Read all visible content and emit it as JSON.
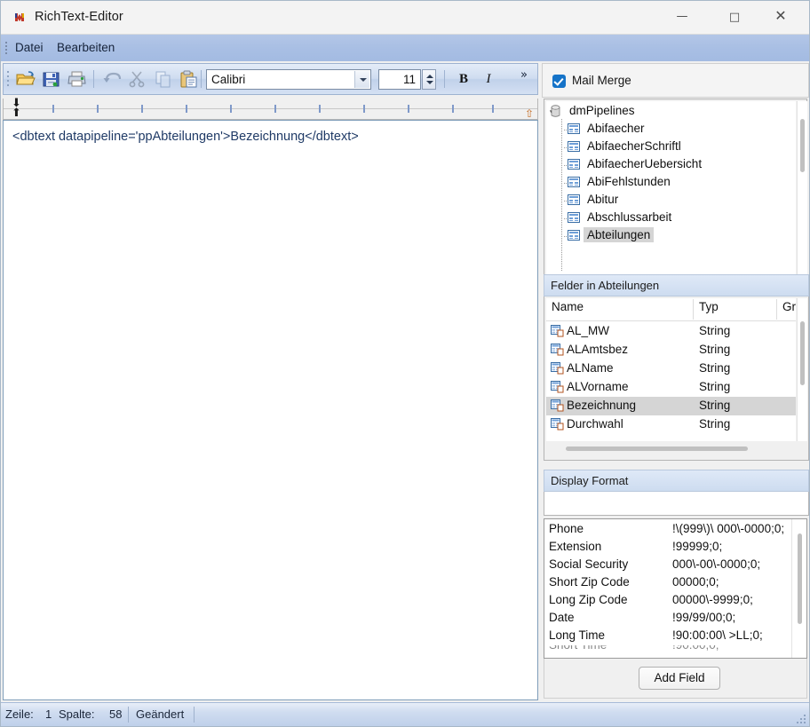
{
  "window": {
    "title": "RichText-Editor",
    "icon": "app-icon",
    "minimize_label": "—",
    "maximize_label": "□",
    "close_label": "✕"
  },
  "menu": {
    "items": [
      {
        "label": "Datei"
      },
      {
        "label": "Bearbeiten"
      }
    ]
  },
  "toolbar": {
    "buttons": [
      {
        "name": "open-button",
        "icon": "open-folder-icon",
        "enabled": true
      },
      {
        "name": "save-button",
        "icon": "floppy-disk-icon",
        "enabled": true
      },
      {
        "name": "print-button",
        "icon": "printer-icon",
        "enabled": true
      },
      {
        "name": "undo-button",
        "icon": "undo-arrow-icon",
        "enabled": false
      },
      {
        "name": "cut-button",
        "icon": "scissors-icon",
        "enabled": false
      },
      {
        "name": "copy-button",
        "icon": "copy-icon",
        "enabled": false
      },
      {
        "name": "paste-button",
        "icon": "clipboard-paste-icon",
        "enabled": true
      }
    ],
    "font_name": "Calibri",
    "font_size": "11",
    "bold_label": "B",
    "italic_label": "I",
    "overflow_label": "»"
  },
  "ruler": {
    "first_line_indent_icon": "indent-down-arrow-icon",
    "left_indent_icon": "indent-up-arrow-icon",
    "right_margin_icon": "right-margin-marker-icon"
  },
  "editor": {
    "content": "<dbtext datapipeline='ppAbteilungen'>Bezeichnung</dbtext>"
  },
  "statusbar": {
    "line_label": "Zeile:",
    "line_value": "1",
    "column_label": "Spalte:",
    "column_value": "58",
    "modified_label": "Geändert"
  },
  "right_panel": {
    "mail_merge": {
      "label": "Mail Merge",
      "checked": true
    },
    "tree": {
      "root": {
        "label": "dmPipelines",
        "icon": "database-icon",
        "expanded": true
      },
      "items": [
        {
          "label": "Abifaecher",
          "icon": "table-icon",
          "selected": false
        },
        {
          "label": "AbifaecherSchriftl",
          "icon": "table-icon",
          "selected": false
        },
        {
          "label": "AbifaecherUebersicht",
          "icon": "table-icon",
          "selected": false
        },
        {
          "label": "AbiFehlstunden",
          "icon": "table-icon",
          "selected": false
        },
        {
          "label": "Abitur",
          "icon": "table-icon",
          "selected": false
        },
        {
          "label": "Abschlussarbeit",
          "icon": "table-icon",
          "selected": false
        },
        {
          "label": "Abteilungen",
          "icon": "table-icon",
          "selected": true
        }
      ]
    },
    "fields": {
      "group_title": "Felder in Abteilungen",
      "columns": [
        "Name",
        "Typ",
        "Gr"
      ],
      "rows": [
        {
          "name": "AL_MW",
          "type": "String",
          "size": "",
          "selected": false
        },
        {
          "name": "ALAmtsbez",
          "type": "String",
          "size": "",
          "selected": false
        },
        {
          "name": "ALName",
          "type": "String",
          "size": "",
          "selected": false
        },
        {
          "name": "ALVorname",
          "type": "String",
          "size": "",
          "selected": false
        },
        {
          "name": "Bezeichnung",
          "type": "String",
          "size": "",
          "selected": true
        },
        {
          "name": "Durchwahl",
          "type": "String",
          "size": "",
          "selected": false
        }
      ]
    },
    "display_format": {
      "group_title": "Display Format",
      "value": "",
      "presets": [
        {
          "name": "Phone",
          "mask": "!\\(999\\)\\ 000\\-0000;0;"
        },
        {
          "name": "Extension",
          "mask": "!99999;0;"
        },
        {
          "name": "Social Security",
          "mask": "000\\-00\\-0000;0;"
        },
        {
          "name": "Short Zip Code",
          "mask": "00000;0;"
        },
        {
          "name": "Long Zip Code",
          "mask": "00000\\-9999;0;"
        },
        {
          "name": "Date",
          "mask": "!99/99/00;0;"
        },
        {
          "name": "Long Time",
          "mask": "!90:00:00\\ >LL;0;"
        }
      ]
    },
    "add_field_label": "Add Field"
  }
}
